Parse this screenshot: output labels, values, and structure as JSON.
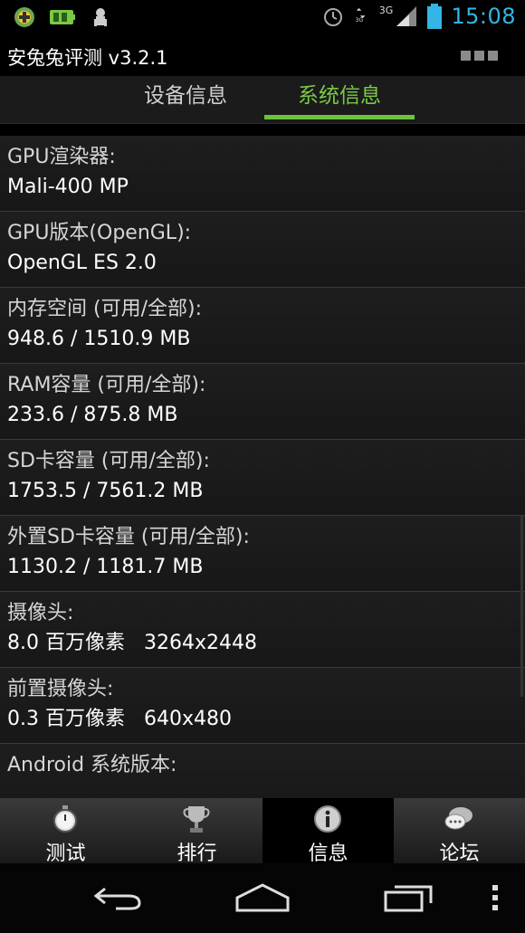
{
  "status": {
    "time": "15:08",
    "network": "3G"
  },
  "app": {
    "title": "安兔兔评测 v3.2.1"
  },
  "tabs": [
    {
      "label": "设备信息",
      "active": false
    },
    {
      "label": "系统信息",
      "active": true
    }
  ],
  "rows": [
    {
      "key": "GPU渲染器:",
      "value": "Mali-400 MP"
    },
    {
      "key": "GPU版本(OpenGL):",
      "value": "OpenGL ES 2.0"
    },
    {
      "key": "内存空间 (可用/全部):",
      "value": "948.6 / 1510.9 MB"
    },
    {
      "key": "RAM容量 (可用/全部):",
      "value": "233.6 / 875.8 MB"
    },
    {
      "key": "SD卡容量 (可用/全部):",
      "value": "1753.5 / 7561.2 MB"
    },
    {
      "key": "外置SD卡容量 (可用/全部):",
      "value": "1130.2 / 1181.7 MB"
    },
    {
      "key": "摄像头:",
      "value": "8.0 百万像素   3264x2448"
    },
    {
      "key": "前置摄像头:",
      "value": "0.3 百万像素   640x480"
    },
    {
      "key": "Android 系统版本:",
      "value": ""
    }
  ],
  "bottom_nav": [
    {
      "label": "测试",
      "icon": "stopwatch-icon",
      "active": false
    },
    {
      "label": "排行",
      "icon": "trophy-icon",
      "active": false
    },
    {
      "label": "信息",
      "icon": "info-icon",
      "active": true
    },
    {
      "label": "论坛",
      "icon": "chat-bubbles-icon",
      "active": false
    }
  ],
  "colors": {
    "accent_green": "#6cc33a",
    "time_blue": "#33b5e5"
  }
}
